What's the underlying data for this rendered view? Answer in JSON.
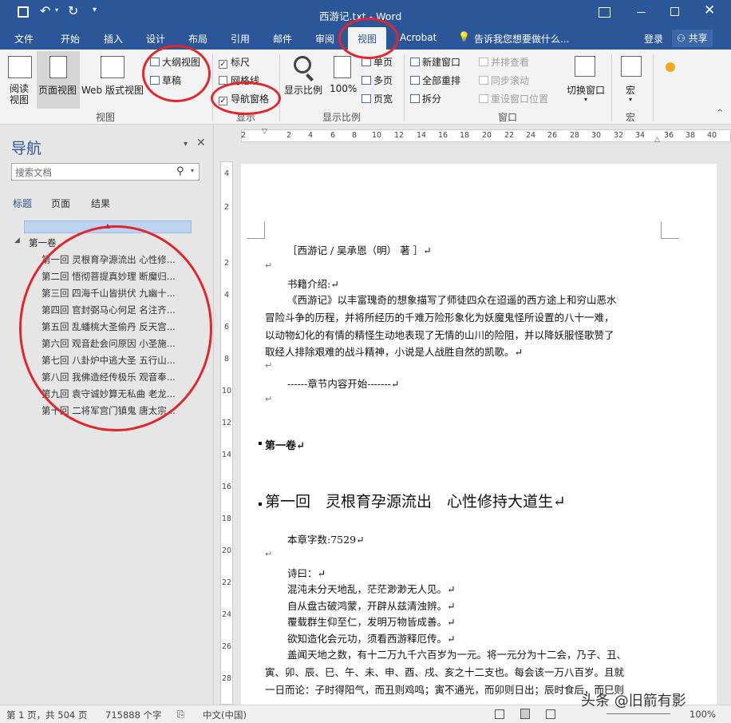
{
  "window": {
    "title": "西游记.txt - Word"
  },
  "tabs": [
    "文件",
    "开始",
    "插入",
    "设计",
    "布局",
    "引用",
    "邮件",
    "审阅",
    "视图",
    "Acrobat"
  ],
  "tell_me": "告诉我您想要做什么...",
  "signin": "登录",
  "share": "共享",
  "ribbon": {
    "views": {
      "read": "阅读\n视图",
      "print": "页面视图",
      "web": "Web 版式视图",
      "outline": "大纲视图",
      "draft": "草稿",
      "group": "视图"
    },
    "show": {
      "ruler": "标尺",
      "grid": "网格线",
      "nav_pane": "导航窗格",
      "group": "显示",
      "ruler_checked": true,
      "grid_checked": false,
      "nav_checked": true
    },
    "zoom": {
      "zoom": "显示比例",
      "p100": "100%",
      "one": "单页",
      "multi": "多页",
      "width": "页宽",
      "group": "显示比例"
    },
    "window": {
      "new": "新建窗口",
      "arrange": "全部重排",
      "split": "拆分",
      "side": "并排查看",
      "sync": "同步滚动",
      "reset": "重设窗口位置",
      "switch": "切换窗口",
      "group": "窗口"
    },
    "macros": {
      "label": "宏",
      "group": "宏"
    }
  },
  "nav": {
    "title": "导航",
    "search_placeholder": "搜索文档",
    "tabs": [
      "标题",
      "页面",
      "结果"
    ],
    "root": "第一卷",
    "items": [
      "第一回 灵根育孕源流出 心性修...",
      "第二回 悟彻菩提真妙理 断魔归...",
      "第三回 四海千山皆拱伏 九幽十...",
      "第四回 官封弼马心何足 名注齐...",
      "第五回 乱蟠桃大圣偷丹 反天宫...",
      "第六回 观音赴会问原因 小圣施...",
      "第七回 八卦炉中逃大圣 五行山...",
      "第八回 我佛造经传极乐 观音奉...",
      "第九回 袁守诚妙算无私曲 老龙...",
      "第十回 二将军宫门镇鬼 唐太宗..."
    ]
  },
  "ruler": {
    "h": [
      "2",
      "2",
      "4",
      "6",
      "8",
      "10",
      "12",
      "14",
      "16",
      "18",
      "20",
      "22",
      "24",
      "26",
      "28",
      "30",
      "32",
      "34",
      "36",
      "38",
      "40"
    ],
    "v": [
      "4",
      "2",
      "2",
      "4",
      "6",
      "8",
      "10",
      "12",
      "14",
      "16",
      "18",
      "20",
      "22",
      "24",
      "26",
      "28"
    ]
  },
  "document": {
    "lines": [
      "［西游记 / 吴承恩（明） 著 ］↵",
      "↵",
      "书籍介绍:↵",
      "《西游记》以丰富瑰奇的想象描写了师徒四众在迢遥的西方途上和穷山恶水",
      "冒险斗争的历程，并将所经历的千难万险形象化为妖魔鬼怪所设置的八十一难，",
      "以动物幻化的有情的精怪生动地表现了无情的山川的险阻，并以降妖服怪歌赞了",
      "取经人排除艰难的战斗精神，小说是人战胜自然的凯歌。↵",
      "↵",
      "------章节内容开始-------↵",
      "↵",
      "第一卷↵",
      "第一回　灵根育孕源流出　心性修持大道生↵",
      "本章字数:7529↵",
      "↵",
      "诗曰：↵",
      "混沌未分天地乱，茫茫渺渺无人见。↵",
      "自从盘古破鸿蒙，开辟从兹清浊辨。↵",
      "覆载群生仰至仁，发明万物皆成善。↵",
      "欲知造化会元功，须看西游释厄传。↵",
      "盖闻天地之数，有十二万九千六百岁为一元。将一元分为十二会，乃子、丑、",
      "寅、卯、辰、巳、午、未、申、酉、戌、亥之十二支也。每会该一万八百岁。且就",
      "一日而论：子时得阳气，而丑则鸡鸣；寅不通光，而卯则日出；辰时食后，而巳则"
    ]
  },
  "status": {
    "page": "第 1 页，共 504 页",
    "words": "715888 个字",
    "lang": "中文(中国)",
    "zoom": "100%",
    "watermark": "头条 @旧箭有影"
  },
  "colors": {
    "accent": "#2b579a",
    "annotation": "#e3262b"
  }
}
